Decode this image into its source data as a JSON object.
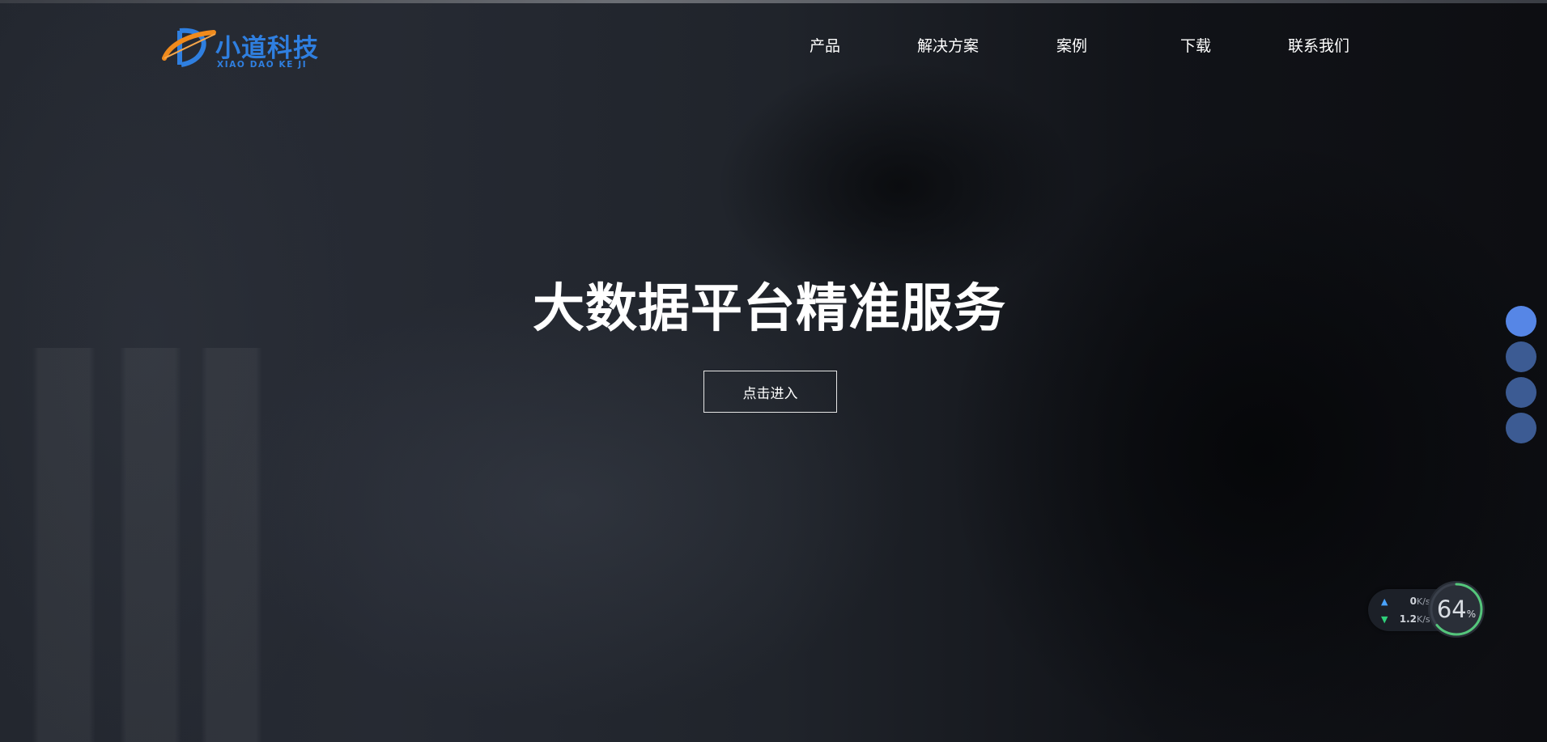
{
  "brand": {
    "name": "小道科技",
    "subtitle": "XIAO DAO KE JI",
    "color": "#2f7fe0",
    "accent": "#f08a1c"
  },
  "nav": {
    "items": [
      "产品",
      "解决方案",
      "案例",
      "下载",
      "联系我们"
    ]
  },
  "hero": {
    "title": "大数据平台精准服务",
    "button_label": "点击进入"
  },
  "pager": {
    "count": 4,
    "active_index": 0,
    "active_color": "#5686e6",
    "inactive_color": "#3c5b93"
  },
  "speed_widget": {
    "upload": {
      "icon": "arrow-up-icon",
      "value": "0",
      "unit": "K/s"
    },
    "download": {
      "icon": "arrow-down-icon",
      "value": "1.2",
      "unit": "K/s"
    },
    "cpu_percent": "64",
    "percent_sign": "%"
  }
}
